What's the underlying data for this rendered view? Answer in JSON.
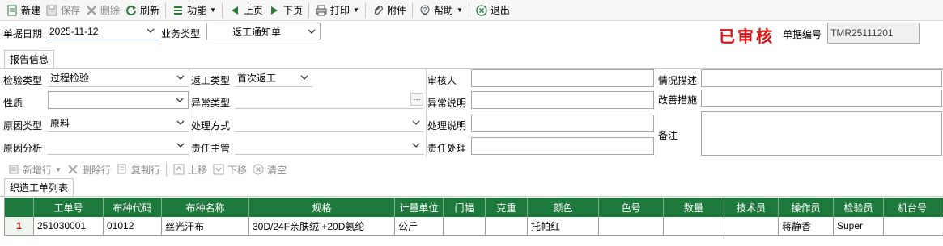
{
  "toolbar": {
    "new": "新建",
    "save": "保存",
    "delete": "删除",
    "refresh": "刷新",
    "function": "功能",
    "prev": "上页",
    "next": "下页",
    "print": "打印",
    "attachment": "附件",
    "help": "帮助",
    "exit": "退出"
  },
  "header": {
    "date_label": "单据日期",
    "date_value": "2025-11-12",
    "biz_type_label": "业务类型",
    "biz_type_value": "返工通知单",
    "status_stamp": "已审核",
    "doc_no_label": "单据编号",
    "doc_no_value": "TMR25111201"
  },
  "tabs": {
    "report_info": "报告信息",
    "work_order_list": "织造工单列表"
  },
  "form": {
    "inspection_type_label": "检验类型",
    "inspection_type_value": "过程检验",
    "rework_type_label": "返工类型",
    "rework_type_value": "首次返工",
    "reviewer_label": "审核人",
    "reviewer_value": "",
    "situation_label": "情况描述",
    "situation_value": "",
    "nature_label": "性质",
    "nature_value": "",
    "abnormal_type_label": "异常类型",
    "abnormal_type_value": "",
    "abnormal_desc_label": "异常说明",
    "abnormal_desc_value": "",
    "improve_label": "改善措施",
    "improve_value": "",
    "cause_type_label": "原因类型",
    "cause_type_value": "原料",
    "handle_method_label": "处理方式",
    "handle_method_value": "",
    "handle_desc_label": "处理说明",
    "handle_desc_value": "",
    "remark_label": "备注",
    "remark_value": "",
    "cause_analysis_label": "原因分析",
    "cause_analysis_value": "",
    "responsible_label": "责任主管",
    "responsible_value": "",
    "resp_handle_label": "责任处理",
    "resp_handle_value": ""
  },
  "subtoolbar": {
    "add_row": "新增行",
    "delete_row": "删除行",
    "copy_row": "复制行",
    "move_up": "上移",
    "move_down": "下移",
    "clear": "清空"
  },
  "grid": {
    "columns": [
      "工单号",
      "布种代码",
      "布种名称",
      "规格",
      "计量单位",
      "门幅",
      "克重",
      "颜色",
      "色号",
      "数量",
      "技术员",
      "操作员",
      "检验员",
      "机台号"
    ],
    "rows": [
      {
        "num": "1",
        "cells": [
          "251030001",
          "01012",
          "丝光汗布",
          "30D/24F亲肤绒 +20D氨纶",
          "公斤",
          "",
          "",
          "托帕红",
          "",
          "",
          "",
          "蒋静香",
          "Super",
          ""
        ]
      }
    ]
  }
}
